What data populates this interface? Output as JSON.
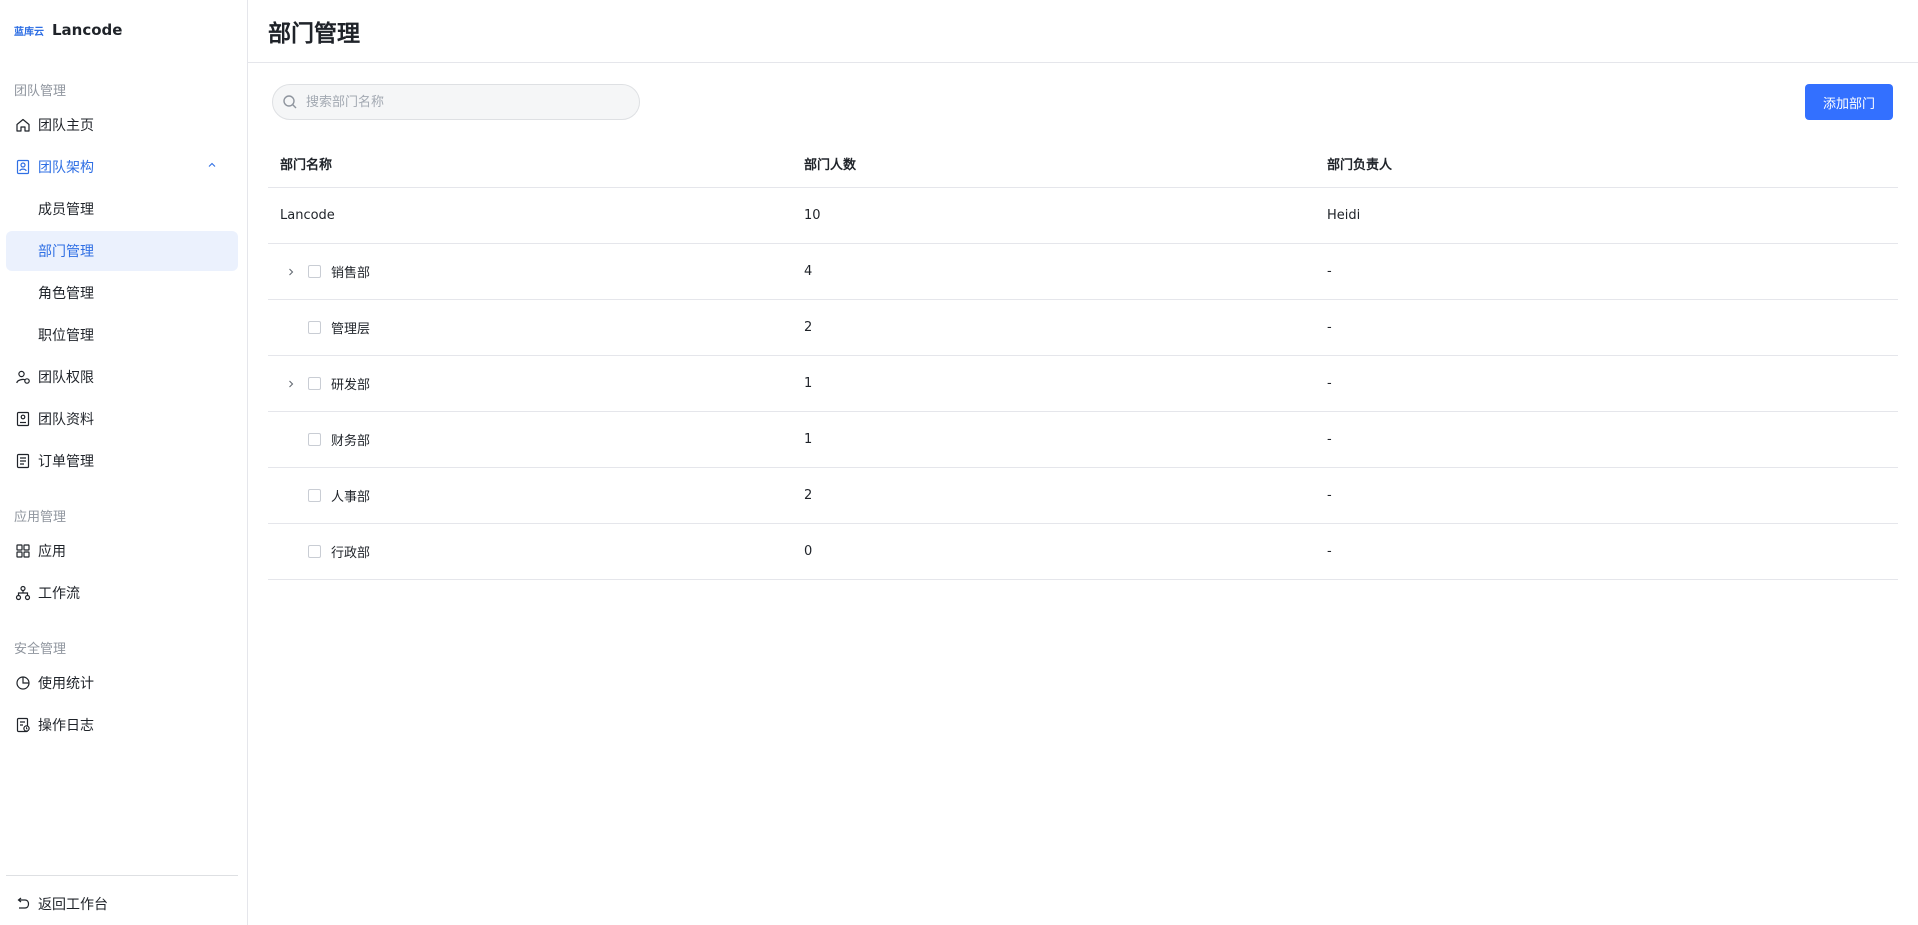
{
  "brand": {
    "logo_text": "蓝库云",
    "name": "Lancode"
  },
  "sidebar": {
    "sections": [
      {
        "label": "团队管理"
      },
      {
        "label": "应用管理"
      },
      {
        "label": "安全管理"
      }
    ],
    "items": [
      {
        "label": "团队主页",
        "icon": "home-icon"
      },
      {
        "label": "团队架构",
        "icon": "org-icon"
      },
      {
        "label": "成员管理"
      },
      {
        "label": "部门管理"
      },
      {
        "label": "角色管理"
      },
      {
        "label": "职位管理"
      },
      {
        "label": "团队权限",
        "icon": "user-permission-icon"
      },
      {
        "label": "团队资料",
        "icon": "profile-card-icon"
      },
      {
        "label": "订单管理",
        "icon": "order-icon"
      },
      {
        "label": "应用",
        "icon": "grid-icon"
      },
      {
        "label": "工作流",
        "icon": "workflow-icon"
      },
      {
        "label": "使用统计",
        "icon": "pie-chart-icon"
      },
      {
        "label": "操作日志",
        "icon": "log-icon"
      }
    ],
    "back": {
      "label": "返回工作台",
      "icon": "undo-icon"
    }
  },
  "page": {
    "title": "部门管理"
  },
  "search": {
    "placeholder": "搜索部门名称",
    "value": ""
  },
  "toolbar": {
    "add_label": "添加部门"
  },
  "colors": {
    "accent": "#3370ff",
    "selected_bg": "#ebf1fd"
  },
  "table": {
    "columns": [
      "部门名称",
      "部门人数",
      "部门负责人"
    ],
    "rows": [
      {
        "name": "Lancode",
        "count": "10",
        "leader": "Heidi"
      },
      {
        "name": "销售部",
        "count": "4",
        "leader": "-"
      },
      {
        "name": "管理层",
        "count": "2",
        "leader": "-"
      },
      {
        "name": "研发部",
        "count": "1",
        "leader": "-"
      },
      {
        "name": "财务部",
        "count": "1",
        "leader": "-"
      },
      {
        "name": "人事部",
        "count": "2",
        "leader": "-"
      },
      {
        "name": "行政部",
        "count": "0",
        "leader": "-"
      }
    ]
  }
}
